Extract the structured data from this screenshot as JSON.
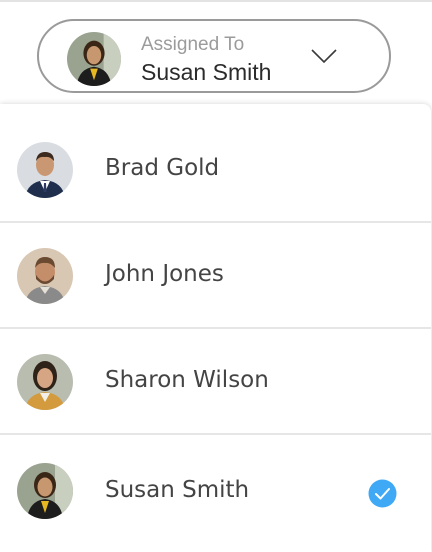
{
  "selector": {
    "caption": "Assigned To",
    "value": "Susan Smith",
    "avatar_icon": "person-avatar-icon",
    "chevron_icon": "chevron-down-icon"
  },
  "options": [
    {
      "name": "Brad Gold",
      "selected": false,
      "avatar_icon": "person-avatar-icon"
    },
    {
      "name": "John Jones",
      "selected": false,
      "avatar_icon": "person-avatar-icon"
    },
    {
      "name": "Sharon Wilson",
      "selected": false,
      "avatar_icon": "person-avatar-icon"
    },
    {
      "name": "Susan Smith",
      "selected": true,
      "avatar_icon": "person-avatar-icon",
      "selected_icon": "checkmark-circle-icon"
    }
  ],
  "colors": {
    "accent": "#3fa9f5",
    "border": "#9a9a9a",
    "text": "#444444",
    "caption": "#9b9b9b"
  }
}
